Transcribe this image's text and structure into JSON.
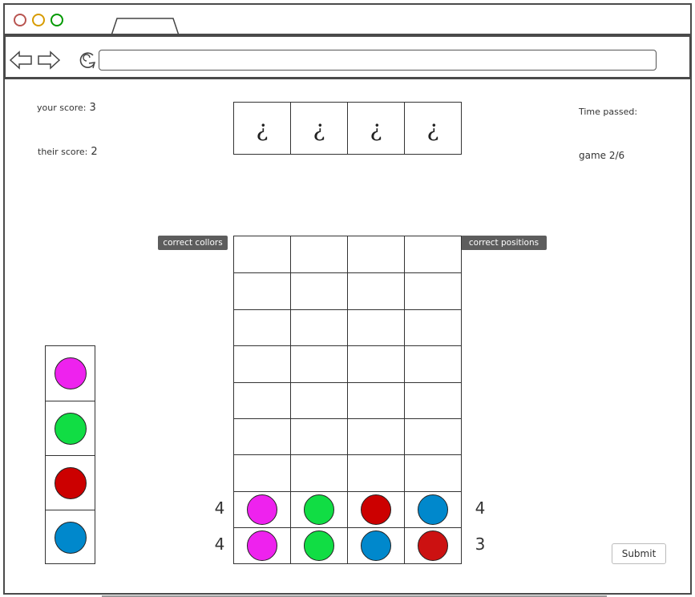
{
  "window": {
    "traffic_colors": [
      "#b85450",
      "#d79b00",
      "#009900"
    ]
  },
  "scores": {
    "your_label": "your score:",
    "your_value": "3",
    "their_label": "their score:",
    "their_value": "2"
  },
  "status": {
    "time_label": "Time passed:",
    "game_label": "game 2/6"
  },
  "answer": [
    "¿",
    "¿",
    "¿",
    "¿"
  ],
  "labels": {
    "correct_colors": "correct collors",
    "correct_positions": "correct positions"
  },
  "board": {
    "empty_rows": 7,
    "guesses": [
      {
        "pegs": [
          "#ee22ee",
          "#11dd44",
          "#cc0000",
          "#0088cc"
        ],
        "correct_colors": "4",
        "correct_positions": "4"
      },
      {
        "pegs": [
          "#ee22ee",
          "#11dd44",
          "#0088cc",
          "#cc1111"
        ],
        "correct_colors": "4",
        "correct_positions": "3"
      }
    ]
  },
  "palette": [
    {
      "name": "magenta",
      "color": "#ee22ee"
    },
    {
      "name": "green",
      "color": "#11dd44"
    },
    {
      "name": "red",
      "color": "#cc0000"
    },
    {
      "name": "blue",
      "color": "#0088cc"
    }
  ],
  "submit_label": "Submit"
}
